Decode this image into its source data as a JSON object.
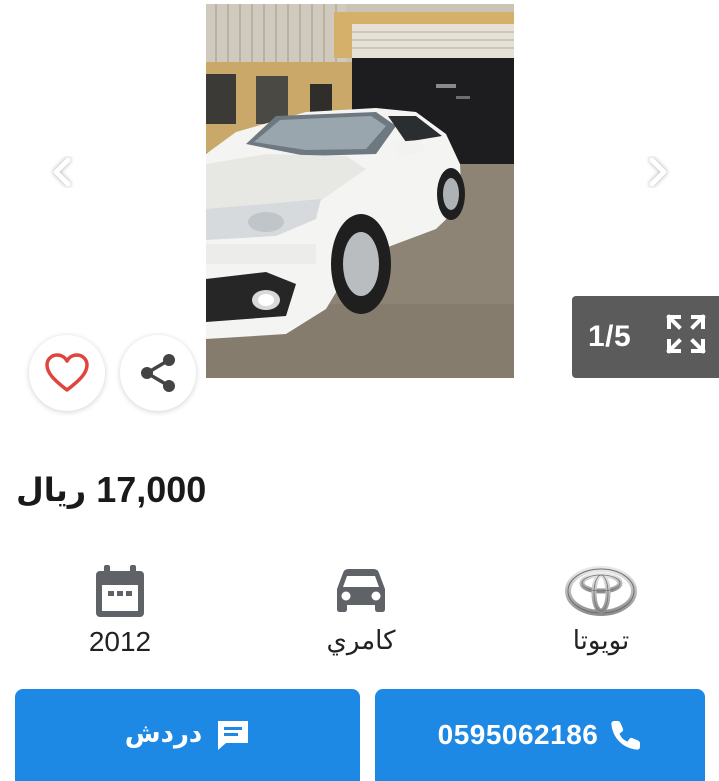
{
  "gallery": {
    "counter": "1/5",
    "photo_alt": "white-toyota-camry-photo"
  },
  "listing": {
    "price_amount": "17,000",
    "price_currency": "ريال"
  },
  "specs": {
    "year": "2012",
    "model": "كامري",
    "make": "تويوتا"
  },
  "actions": {
    "chat_label": "دردش",
    "phone_number": "0595062186"
  },
  "icons": {
    "favorite": "heart-icon",
    "share": "share-icon",
    "fullscreen": "fullscreen-icon",
    "prev": "chevron-left-icon",
    "next": "chevron-right-icon",
    "year": "calendar-icon",
    "model": "car-icon",
    "make": "toyota-logo-icon",
    "chat": "chat-icon",
    "phone": "phone-icon"
  },
  "colors": {
    "primary_button": "#1e88e5",
    "heart": "#e0443e",
    "counter_bg": "#5b5b5b",
    "spec_icon": "#5f6368"
  }
}
